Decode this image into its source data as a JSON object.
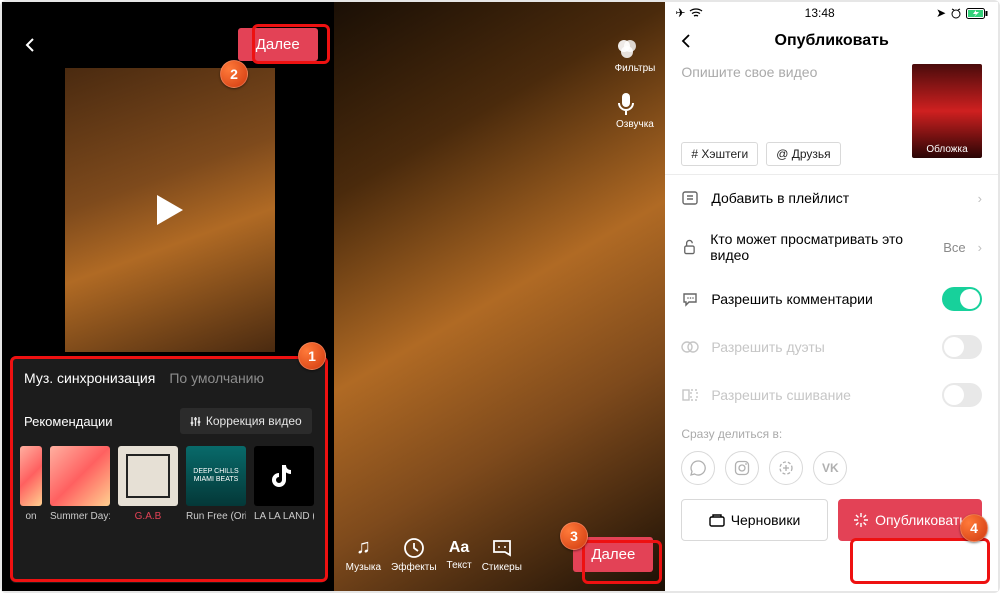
{
  "annotations": {
    "b1": "1",
    "b2": "2",
    "b3": "3",
    "b4": "4"
  },
  "panel1": {
    "next": "Далее",
    "tabs": {
      "sync": "Муз. синхронизация",
      "default": "По умолчанию"
    },
    "recs": "Рекомендации",
    "correction": "Коррекция видео",
    "thumbs": [
      {
        "label": "Summer Day:"
      },
      {
        "label": "G.A.B"
      },
      {
        "label": "Run Free (Ori"
      },
      {
        "label": "LA LA LAND ("
      }
    ],
    "miami": "DEEP CHILLS MIAMI BEATS",
    "partial": "on"
  },
  "panel2": {
    "side": {
      "filters": "Фильтры",
      "voice": "Озвучка"
    },
    "bottom": {
      "music": "Музыка",
      "effects": "Эффекты",
      "text": "Текст",
      "stickers": "Стикеры"
    },
    "next": "Далее"
  },
  "panel3": {
    "status_time": "13:48",
    "title": "Опубликовать",
    "placeholder": "Опишите свое видео",
    "cover": "Обложка",
    "chip_hash": "# Хэштеги",
    "chip_friends": "@ Друзья",
    "items": {
      "playlist": "Добавить в плейлист",
      "privacy": "Кто может просматривать это видео",
      "privacy_val": "Все",
      "comments": "Разрешить комментарии",
      "duet": "Разрешить дуэты",
      "stitch": "Разрешить сшивание"
    },
    "share_label": "Сразу делиться в:",
    "drafts": "Черновики",
    "publish": "Опубликовать"
  }
}
